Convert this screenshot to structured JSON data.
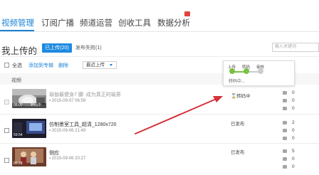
{
  "tabs": [
    {
      "label": "视频管理",
      "active": true
    },
    {
      "label": "订阅广播",
      "active": false
    },
    {
      "label": "频道运营",
      "active": false
    },
    {
      "label": "创收工具",
      "active": false
    },
    {
      "label": "数据分析",
      "active": false
    }
  ],
  "page": {
    "title": "我上传的",
    "filter_uploaded": "已上传(20)",
    "filter_failed": "发布失败(1)",
    "search_placeholder": "输入关键词"
  },
  "toolbar": {
    "select_all": "全选",
    "add_to_album": "添加到专辑",
    "delete": "删除",
    "sort_selected": "最近上传"
  },
  "table": {
    "column_video": "视频"
  },
  "videos": [
    {
      "title": "瑜伽最健身7 腰: 成为真正的瑜男",
      "date": "2015-09-07 06:59",
      "duration": "06:00",
      "overlay": "转码中",
      "status": "转码中",
      "stats": [
        "0",
        "0",
        "0"
      ],
      "pending": true
    },
    {
      "title": "仿制墨室工具_超清_1280x720",
      "date": "2015-09-06 21:49",
      "duration": "59:54",
      "status": "已发布",
      "stats": [
        "2",
        "0",
        "0"
      ],
      "pending": false
    },
    {
      "title": "侧应",
      "date": "2015-09-06 20:27",
      "duration": "00:28",
      "status": "已发布",
      "stats": [
        "5",
        "0",
        "0"
      ],
      "pending": false
    }
  ],
  "progress": {
    "steps": [
      "上传",
      "转码",
      "审核"
    ],
    "current_step": 2,
    "status_text": "转码中..."
  },
  "colors": {
    "accent": "#1a82d6",
    "progress_done": "#7ac143",
    "progress_pending": "#cccccc",
    "arrow": "#d4313a",
    "badge": "#e0443d"
  },
  "icons": {
    "pending": "hourglass-icon",
    "views": "play-count-icon",
    "comments": "comment-icon",
    "favorites": "favorite-icon",
    "date": "calendar-icon"
  }
}
